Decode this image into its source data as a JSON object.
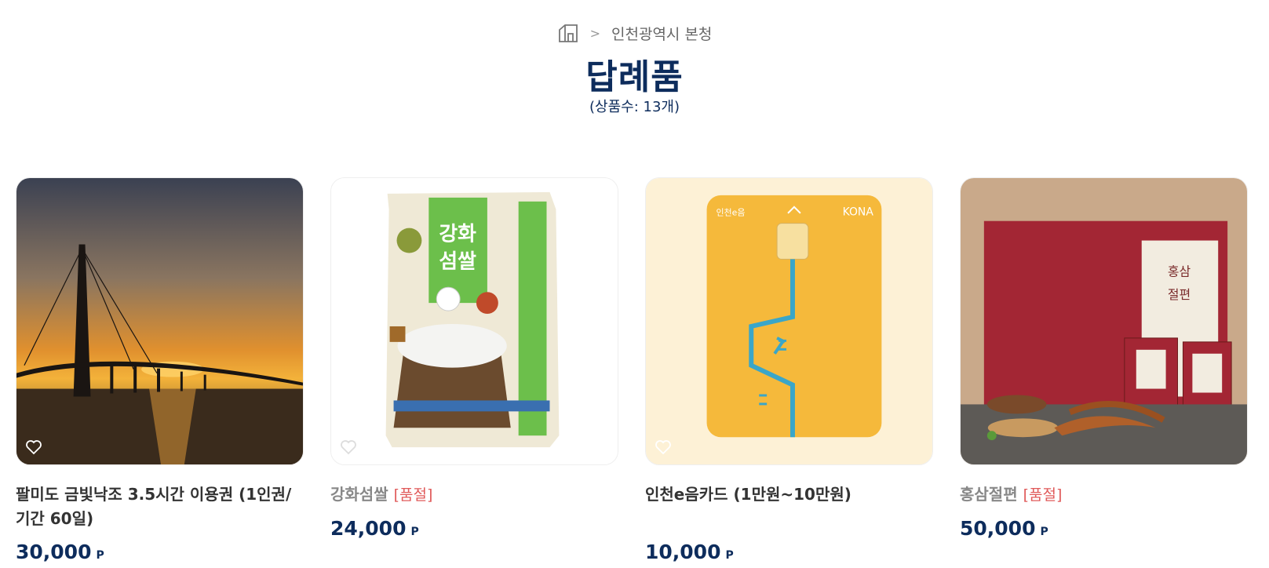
{
  "breadcrumb": {
    "home_icon": "home-icon",
    "separator": ">",
    "current": "인천광역시 본청"
  },
  "page": {
    "title": "답례품",
    "count_text": "(상품수: 13개)"
  },
  "products": [
    {
      "name": "팔미도 금빛낙조 3.5시간 이용권 (1인권/기간 60일)",
      "soldout": "",
      "price": "30,000",
      "unit": "P",
      "image": "sunset-bridge-photo"
    },
    {
      "name": "강화섬쌀",
      "soldout": "[품절]",
      "price": "24,000",
      "unit": "P",
      "image": "rice-bag-photo"
    },
    {
      "name": "인천e음카드 (1만원~10만원)",
      "soldout": "",
      "price": "10,000",
      "unit": "P",
      "image": "card-photo"
    },
    {
      "name": "홍삼절편",
      "soldout": "[품절]",
      "price": "50,000",
      "unit": "P",
      "image": "red-ginseng-photo"
    }
  ],
  "colors": {
    "title": "#0d2c5c",
    "soldout": "#e05a5a",
    "card_yellow": "#f5b93b"
  }
}
